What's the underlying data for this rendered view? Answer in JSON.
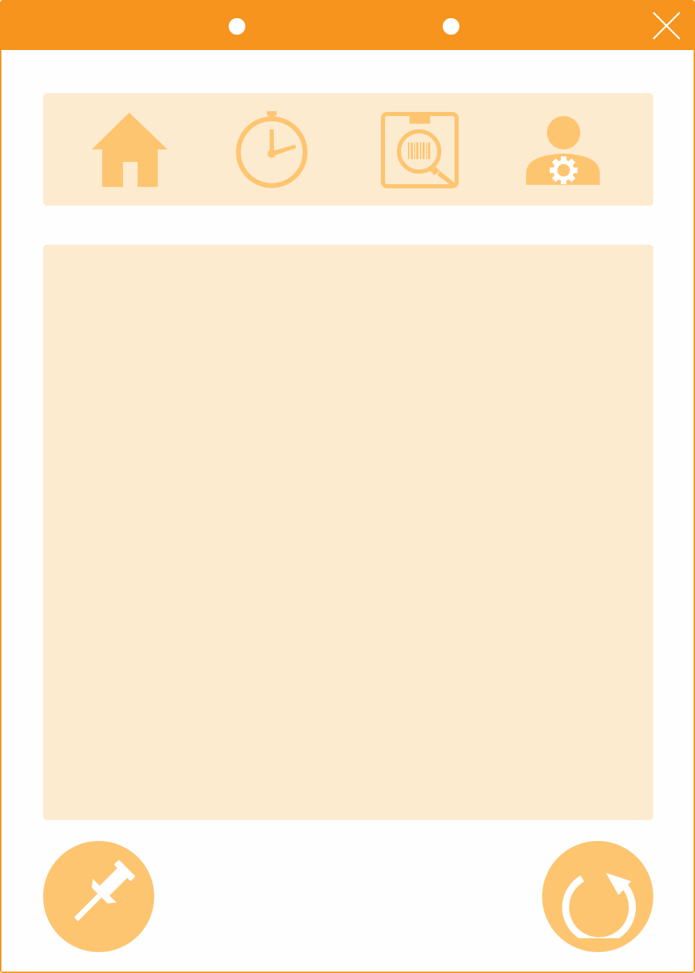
{
  "window": {
    "accent_color": "#f7941d",
    "icon_color": "#fec571",
    "panel_color": "#fdebd0",
    "close_icon": "close-icon"
  },
  "toolbar": {
    "items": [
      {
        "icon": "home-icon"
      },
      {
        "icon": "stopwatch-icon"
      },
      {
        "icon": "barcode-scan-icon"
      },
      {
        "icon": "user-settings-icon"
      }
    ]
  },
  "actions": {
    "left": {
      "icon": "pin-icon"
    },
    "right": {
      "icon": "refresh-icon"
    }
  }
}
